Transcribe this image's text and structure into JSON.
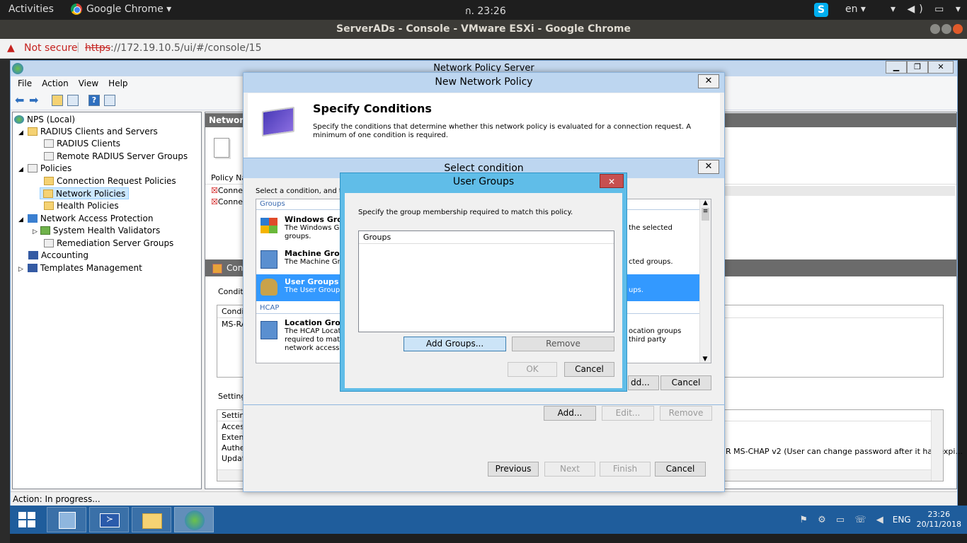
{
  "gnome": {
    "activities": "Activities",
    "app": "Google Chrome ▾",
    "clock": "ก. 23:26",
    "lang": "en ▾",
    "sys": "▾ ◀) ▭ ▾"
  },
  "chrome": {
    "title": "ServerADs - Console - VMware ESXi - Google Chrome",
    "not_secure": "Not secure",
    "https": "https",
    "url_rest": "://172.19.10.5/ui/#/console/15"
  },
  "nps": {
    "title": "Network Policy Server",
    "menu": [
      "File",
      "Action",
      "View",
      "Help"
    ],
    "tree": [
      {
        "label": "NPS (Local)",
        "level": 0,
        "icon": "nps-globe-icon"
      },
      {
        "label": "RADIUS Clients and Servers",
        "level": 1,
        "icon": "folder-icon"
      },
      {
        "label": "RADIUS Clients",
        "level": 2,
        "icon": "document-icon"
      },
      {
        "label": "Remote RADIUS Server Groups",
        "level": 2,
        "icon": "document-icon"
      },
      {
        "label": "Policies",
        "level": 1,
        "icon": "document-icon"
      },
      {
        "label": "Connection Request Policies",
        "level": 2,
        "icon": "folder-icon"
      },
      {
        "label": "Network Policies",
        "level": 2,
        "icon": "folder-icon",
        "selected": true
      },
      {
        "label": "Health Policies",
        "level": 2,
        "icon": "folder-icon"
      },
      {
        "label": "Network Access Protection",
        "level": 1,
        "icon": "nap-icon"
      },
      {
        "label": "System Health Validators",
        "level": 2,
        "icon": "chart-icon"
      },
      {
        "label": "Remediation Server Groups",
        "level": 2,
        "icon": "document-icon"
      },
      {
        "label": "Accounting",
        "level": 1,
        "icon": "accounting-icon"
      },
      {
        "label": "Templates Management",
        "level": 1,
        "icon": "templates-icon"
      }
    ],
    "status": "Action:  In progress...",
    "rpane": {
      "header": "Network",
      "policy_col": "Policy Nar",
      "row1": "Conne",
      "row2": "Conne",
      "conn_bar": "Conn",
      "conditions_label": "Conditio",
      "cond_col": "Conditi",
      "cond_row": "MS-RA",
      "settings_label": "Settings",
      "settings_col": "Setting",
      "s_rows": [
        "Access",
        "Extens",
        "Authen",
        "Update"
      ],
      "right_text": "R MS-CHAP v2 (User can change password after it has expi..."
    }
  },
  "wizard": {
    "title": "New Network Policy",
    "heading": "Specify Conditions",
    "desc": "Specify the conditions that determine whether this network policy is evaluated for a connection request. A minimum of one condition is required.",
    "buttons": {
      "add": "Add...",
      "edit": "Edit...",
      "remove": "Remove",
      "previous": "Previous",
      "next": "Next",
      "finish": "Finish",
      "cancel": "Cancel"
    }
  },
  "select_condition": {
    "title": "Select condition",
    "intro": "Select a condition, and th",
    "group_groups": "Groups",
    "group_hcap": "HCAP",
    "items": [
      {
        "name": "Windows Group",
        "desc": "The Windows G",
        "desc2": "groups.",
        "right": "the selected"
      },
      {
        "name": "Machine Group",
        "desc": "The Machine Gr",
        "right": "cted groups."
      },
      {
        "name": "User Groups",
        "desc": "The User Group",
        "right": "ups.",
        "selected": true
      },
      {
        "name": "Location Group",
        "desc": "The HCAP Locat",
        "desc2": "required to matc",
        "desc3": "network access",
        "right": "ocation groups",
        "right2": "third party"
      }
    ],
    "add_btn": "dd...",
    "cancel_btn": "Cancel"
  },
  "user_groups": {
    "title": "User Groups",
    "desc": "Specify the group membership required to match this policy.",
    "list_header": "Groups",
    "add_groups": "Add Groups...",
    "remove": "Remove",
    "ok": "OK",
    "cancel": "Cancel"
  },
  "taskbar": {
    "lang": "ENG",
    "time": "23:26",
    "date": "20/11/2018"
  }
}
